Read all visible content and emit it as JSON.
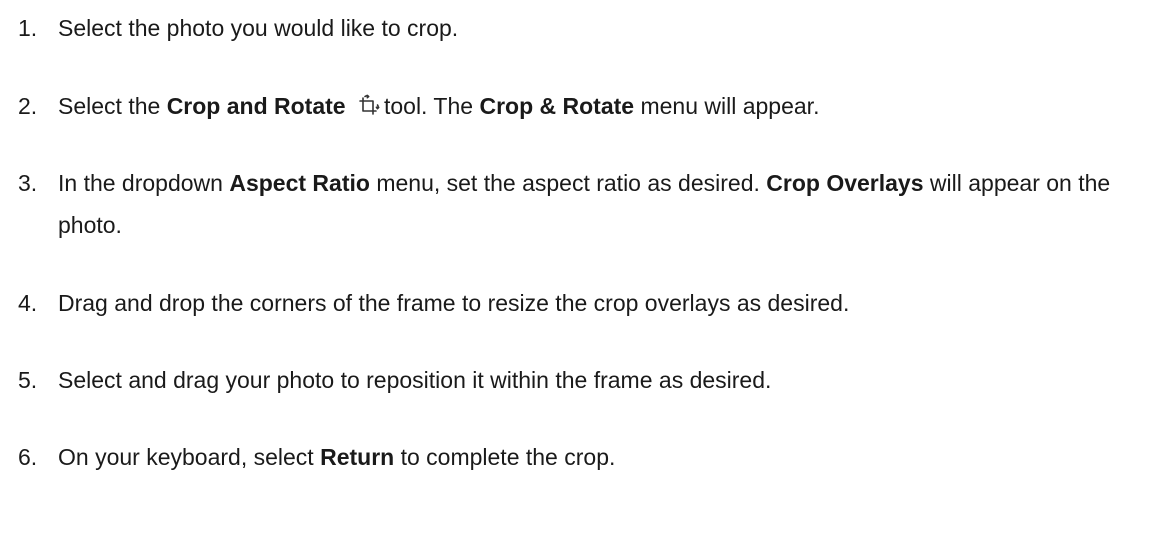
{
  "steps": [
    {
      "num": "1.",
      "parts": [
        {
          "t": "Select the photo you would like to crop.",
          "b": false
        }
      ]
    },
    {
      "num": "2.",
      "parts": [
        {
          "t": "Select the ",
          "b": false
        },
        {
          "t": "Crop and Rotate",
          "b": true
        },
        {
          "icon": "crop-rotate-icon"
        },
        {
          "t": "tool. The ",
          "b": false
        },
        {
          "t": "Crop & Rotate",
          "b": true
        },
        {
          "t": " menu will appear.",
          "b": false
        }
      ]
    },
    {
      "num": "3.",
      "parts": [
        {
          "t": "In the dropdown ",
          "b": false
        },
        {
          "t": "Aspect Ratio",
          "b": true
        },
        {
          "t": " menu, set the aspect ratio as desired. ",
          "b": false
        },
        {
          "t": "Crop Overlays",
          "b": true
        },
        {
          "t": " will appear on the photo.",
          "b": false
        }
      ]
    },
    {
      "num": "4.",
      "parts": [
        {
          "t": "Drag and drop the corners of the frame to resize the crop overlays as desired.",
          "b": false
        }
      ]
    },
    {
      "num": "5.",
      "parts": [
        {
          "t": "Select and drag your photo to reposition it within the frame as desired.",
          "b": false
        }
      ]
    },
    {
      "num": "6.",
      "parts": [
        {
          "t": "On your keyboard, select ",
          "b": false
        },
        {
          "t": "Return",
          "b": true
        },
        {
          "t": " to complete the crop.",
          "b": false
        }
      ]
    }
  ]
}
